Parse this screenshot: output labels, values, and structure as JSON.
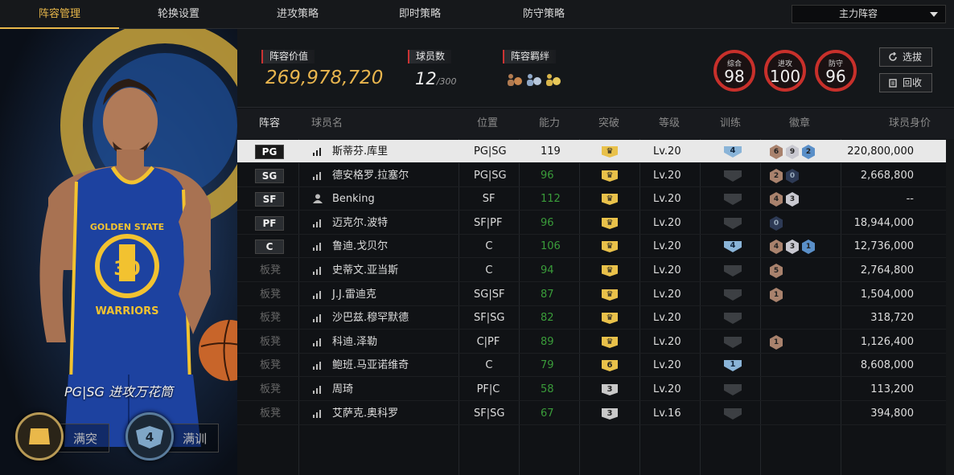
{
  "nav": {
    "tabs": [
      "阵容管理",
      "轮换设置",
      "进攻策略",
      "即时策略",
      "防守策略"
    ],
    "active_tab": 0,
    "lineup_select": "主力阵容"
  },
  "player_card": {
    "jersey_team": "GOLDEN STATE",
    "jersey_number": "30",
    "jersey_city": "WARRIORS",
    "tag": "PG|SG 进攻万花筒",
    "breakout_label": "满突",
    "training_level": "4",
    "training_label": "满训"
  },
  "summary": {
    "value_label": "阵容价值",
    "value": "269,978,720",
    "players_label": "球员数",
    "players_count": "12",
    "players_max": "/300",
    "synergy_label": "阵容羁绊",
    "synergy_icons": [
      "people-coin-icon",
      "people-dollar-icon",
      "people-gold-icon"
    ],
    "ratings": [
      {
        "label": "综合",
        "value": "98"
      },
      {
        "label": "进攻",
        "value": "100"
      },
      {
        "label": "防守",
        "value": "96"
      }
    ],
    "buttons": {
      "draft": "选拔",
      "recycle": "回收"
    }
  },
  "table": {
    "headers": [
      "阵容",
      "球员名",
      "位置",
      "能力",
      "突破",
      "等级",
      "训练",
      "徽章",
      "球员身价"
    ],
    "rows": [
      {
        "slot": "PG",
        "bench": false,
        "icon": "signal",
        "name": "斯蒂芬.库里",
        "pos": "PG|SG",
        "ability": "119",
        "break": "crown",
        "break_color": "gold",
        "level": "Lv.20",
        "train": "4",
        "badges": [
          {
            "t": "bronze",
            "v": "6"
          },
          {
            "t": "silver",
            "v": "9"
          },
          {
            "t": "blue",
            "v": "2"
          }
        ],
        "value": "220,800,000"
      },
      {
        "slot": "SG",
        "bench": false,
        "icon": "signal",
        "name": "德安格罗.拉塞尔",
        "pos": "PG|SG",
        "ability": "96",
        "break": "crown",
        "break_color": "gold",
        "level": "Lv.20",
        "train": "",
        "badges": [
          {
            "t": "bronze",
            "v": "2"
          },
          {
            "t": "navy",
            "v": "0"
          }
        ],
        "value": "2,668,800"
      },
      {
        "slot": "SF",
        "bench": false,
        "icon": "person",
        "name": "Benking",
        "pos": "SF",
        "ability": "112",
        "break": "crown",
        "break_color": "gold",
        "level": "Lv.20",
        "train": "",
        "badges": [
          {
            "t": "bronze",
            "v": "4"
          },
          {
            "t": "silver",
            "v": "3"
          }
        ],
        "value": "--"
      },
      {
        "slot": "PF",
        "bench": false,
        "icon": "signal",
        "name": "迈克尔.波特",
        "pos": "SF|PF",
        "ability": "96",
        "break": "crown",
        "break_color": "gold",
        "level": "Lv.20",
        "train": "",
        "badges": [
          {
            "t": "navy",
            "v": "0"
          }
        ],
        "value": "18,944,000"
      },
      {
        "slot": "C",
        "bench": false,
        "icon": "signal",
        "name": "鲁迪.戈贝尔",
        "pos": "C",
        "ability": "106",
        "break": "crown",
        "break_color": "gold",
        "level": "Lv.20",
        "train": "4",
        "badges": [
          {
            "t": "bronze",
            "v": "4"
          },
          {
            "t": "silver",
            "v": "3"
          },
          {
            "t": "blue",
            "v": "1"
          }
        ],
        "value": "12,736,000"
      },
      {
        "slot": "板凳",
        "bench": true,
        "icon": "signal",
        "name": "史蒂文.亚当斯",
        "pos": "C",
        "ability": "94",
        "break": "crown",
        "break_color": "gold",
        "level": "Lv.20",
        "train": "",
        "badges": [
          {
            "t": "bronze",
            "v": "5"
          }
        ],
        "value": "2,764,800"
      },
      {
        "slot": "板凳",
        "bench": true,
        "icon": "signal",
        "name": "J.J.雷迪克",
        "pos": "SG|SF",
        "ability": "87",
        "break": "crown",
        "break_color": "gold",
        "level": "Lv.20",
        "train": "",
        "badges": [
          {
            "t": "bronze",
            "v": "1"
          }
        ],
        "value": "1,504,000"
      },
      {
        "slot": "板凳",
        "bench": true,
        "icon": "signal",
        "name": "沙巴兹.穆罕默德",
        "pos": "SF|SG",
        "ability": "82",
        "break": "crown",
        "break_color": "gold",
        "level": "Lv.20",
        "train": "",
        "badges": [],
        "value": "318,720"
      },
      {
        "slot": "板凳",
        "bench": true,
        "icon": "signal",
        "name": "科迪.泽勒",
        "pos": "C|PF",
        "ability": "89",
        "break": "crown",
        "break_color": "gold",
        "level": "Lv.20",
        "train": "",
        "badges": [
          {
            "t": "bronze",
            "v": "1"
          }
        ],
        "value": "1,126,400"
      },
      {
        "slot": "板凳",
        "bench": true,
        "icon": "signal",
        "name": "鲍班.马亚诺维奇",
        "pos": "C",
        "ability": "79",
        "break": "6",
        "break_color": "gold",
        "level": "Lv.20",
        "train": "1",
        "badges": [],
        "value": "8,608,000"
      },
      {
        "slot": "板凳",
        "bench": true,
        "icon": "signal",
        "name": "周琦",
        "pos": "PF|C",
        "ability": "58",
        "break": "3",
        "break_color": "silver",
        "level": "Lv.20",
        "train": "",
        "badges": [],
        "value": "113,200"
      },
      {
        "slot": "板凳",
        "bench": true,
        "icon": "signal",
        "name": "艾萨克.奥科罗",
        "pos": "SF|SG",
        "ability": "67",
        "break": "3",
        "break_color": "silver",
        "level": "Lv.16",
        "train": "",
        "badges": [],
        "value": "394,800"
      }
    ]
  },
  "colors": {
    "accent": "#e9b84a",
    "rating_ring": "#c8302b",
    "ability_green": "#3a9c3a"
  }
}
